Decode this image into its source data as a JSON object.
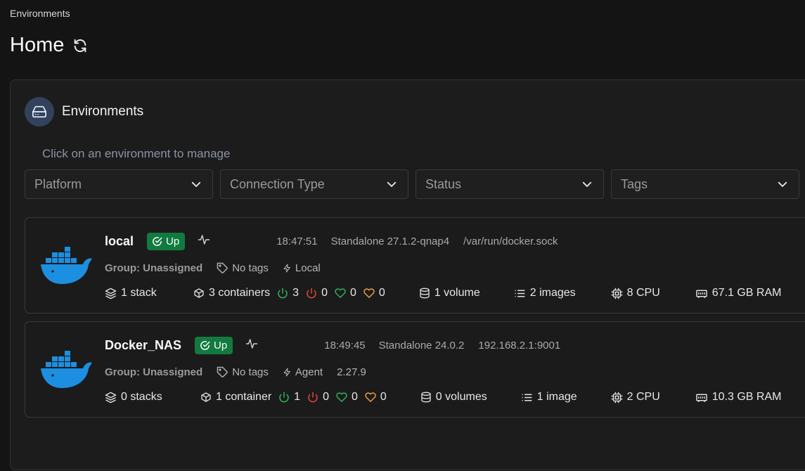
{
  "breadcrumb": "Environments",
  "page": {
    "title": "Home"
  },
  "widget": {
    "title": "Environments",
    "hint": "Click on an environment to manage",
    "filters": [
      {
        "placeholder": "Platform"
      },
      {
        "placeholder": "Connection Type"
      },
      {
        "placeholder": "Status"
      },
      {
        "placeholder": "Tags"
      }
    ]
  },
  "environments": [
    {
      "name": "local",
      "status": "Up",
      "time": "18:47:51",
      "version": "Standalone 27.1.2-qnap4",
      "url": "/var/run/docker.sock",
      "group": "Group: Unassigned",
      "tags": "No tags",
      "connection": "Local",
      "agent_version": "",
      "stacks": "1 stack",
      "containers": "3 containers",
      "running": "3",
      "stopped": "0",
      "healthy": "0",
      "unhealthy": "0",
      "volumes": "1 volume",
      "images": "2 images",
      "cpu": "8 CPU",
      "ram": "67.1 GB RAM"
    },
    {
      "name": "Docker_NAS",
      "status": "Up",
      "time": "18:49:45",
      "version": "Standalone 24.0.2",
      "url": "192.168.2.1:9001",
      "group": "Group: Unassigned",
      "tags": "No tags",
      "connection": "Agent",
      "agent_version": "2.27.9",
      "stacks": "0 stacks",
      "containers": "1 container",
      "running": "1",
      "stopped": "0",
      "healthy": "0",
      "unhealthy": "0",
      "volumes": "0 volumes",
      "images": "1 image",
      "cpu": "2 CPU",
      "ram": "10.3 GB RAM"
    }
  ],
  "colors": {
    "background": "#141414",
    "up_badge": "#127a3f",
    "docker_blue": "#1d8fe0",
    "running_green": "#2fb35a",
    "stopped_red": "#e0463a",
    "healthy_green": "#2fb35a",
    "unhealthy_orange": "#f0a040"
  },
  "icons": {
    "refresh": "refresh-icon",
    "widget": "hard-drive-icon",
    "filter_chevron": "chevron-down-icon",
    "env_logo": "docker-logo-icon",
    "heartbeat": "heartbeat-icon",
    "tag": "tag-icon",
    "connection": "zap-icon",
    "stack": "layers-icon",
    "container": "box-icon",
    "running": "power-icon",
    "stopped": "power-icon",
    "healthy": "heart-icon",
    "unhealthy": "heart-icon",
    "volume": "database-icon",
    "images": "list-icon",
    "cpu": "cpu-icon",
    "ram": "memory-icon"
  }
}
